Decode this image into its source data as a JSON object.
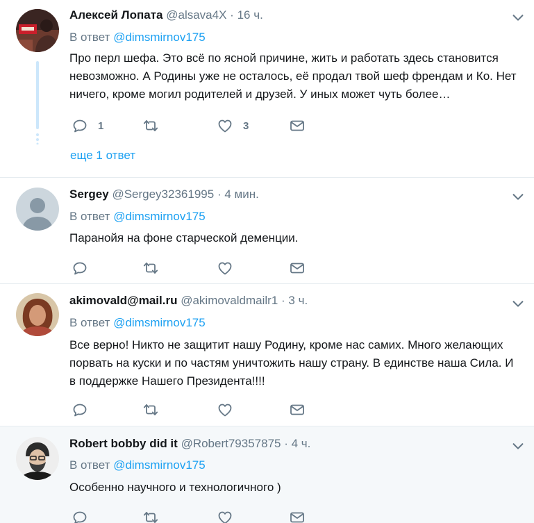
{
  "reply_prefix": "В ответ",
  "tweets": [
    {
      "name": "Алексей Лопата",
      "handle": "@alsava4X",
      "separator": "·",
      "time": "16 ч.",
      "reply_to": "@dimsmirnov175",
      "text": "Про перл шефа. Это всё по ясной причине, жить и работать здесь становится невозможно. А Родины уже не осталось, её продал твой шеф френдам и Ко. Нет ничего, кроме могил родителей и друзей. У иных может чуть более…",
      "reply_count": "1",
      "retweet_count": "",
      "like_count": "3",
      "more_replies": "еще 1 ответ"
    },
    {
      "name": "Sergey",
      "handle": "@Sergey32361995",
      "separator": "·",
      "time": "4 мин.",
      "reply_to": "@dimsmirnov175",
      "text": "Паранойя на фоне старческой деменции.",
      "reply_count": "",
      "retweet_count": "",
      "like_count": ""
    },
    {
      "name": "akimovald@mail.ru",
      "handle": "@akimovaldmailr1",
      "separator": "·",
      "time": "3 ч.",
      "reply_to": "@dimsmirnov175",
      "text": "Все верно! Никто не защитит  нашу Родину, кроме нас самих. Много желающих порвать на куски и по частям уничтожить нашу страну. В единстве наша Сила. И в поддержке Нашего Президента!!!!",
      "reply_count": "",
      "retweet_count": "",
      "like_count": ""
    },
    {
      "name": "Robert bobby did it",
      "handle": "@Robert79357875",
      "separator": "·",
      "time": "4 ч.",
      "reply_to": "@dimsmirnov175",
      "text": "Особенно научного и технологичного )",
      "reply_count": "",
      "retweet_count": "",
      "like_count": ""
    }
  ],
  "colors": {
    "accent": "#1da1f2",
    "secondary_text": "#657786",
    "border": "#e6ecf0",
    "highlight_bg": "#f5f8fa",
    "thread_line": "#cce7fb"
  }
}
